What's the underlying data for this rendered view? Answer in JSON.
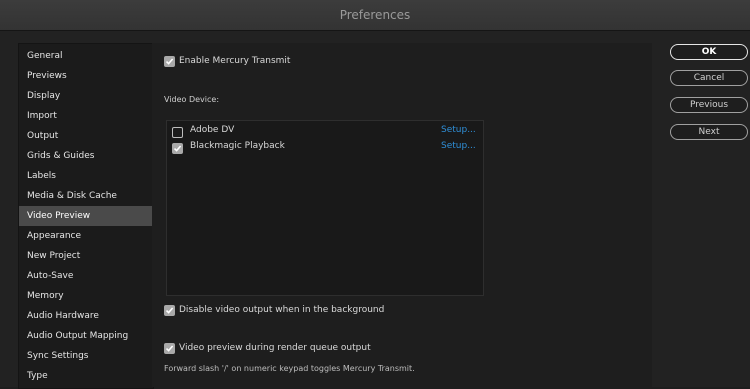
{
  "window": {
    "title": "Preferences"
  },
  "sidebar": {
    "items": [
      {
        "label": "General"
      },
      {
        "label": "Previews"
      },
      {
        "label": "Display"
      },
      {
        "label": "Import"
      },
      {
        "label": "Output"
      },
      {
        "label": "Grids & Guides"
      },
      {
        "label": "Labels"
      },
      {
        "label": "Media & Disk Cache"
      },
      {
        "label": "Video Preview"
      },
      {
        "label": "Appearance"
      },
      {
        "label": "New Project"
      },
      {
        "label": "Auto-Save"
      },
      {
        "label": "Memory"
      },
      {
        "label": "Audio Hardware"
      },
      {
        "label": "Audio Output Mapping"
      },
      {
        "label": "Sync Settings"
      },
      {
        "label": "Type"
      }
    ],
    "selected": "Video Preview"
  },
  "main": {
    "enable_mercury": {
      "label": "Enable Mercury Transmit",
      "checked": true
    },
    "video_device_label": "Video Device:",
    "devices": [
      {
        "name": "Adobe DV",
        "checked": false,
        "setup_label": "Setup..."
      },
      {
        "name": "Blackmagic Playback",
        "checked": true,
        "setup_label": "Setup..."
      }
    ],
    "disable_background": {
      "label": "Disable video output when in the background",
      "checked": true
    },
    "render_queue": {
      "label": "Video preview during render queue output",
      "checked": true
    },
    "hint": "Forward slash '/' on numeric keypad toggles Mercury Transmit."
  },
  "buttons": {
    "ok": "OK",
    "cancel": "Cancel",
    "previous": "Previous",
    "next": "Next"
  },
  "colors": {
    "accent_link": "#2f8fd8",
    "selected_bg": "#4a4a4a"
  }
}
